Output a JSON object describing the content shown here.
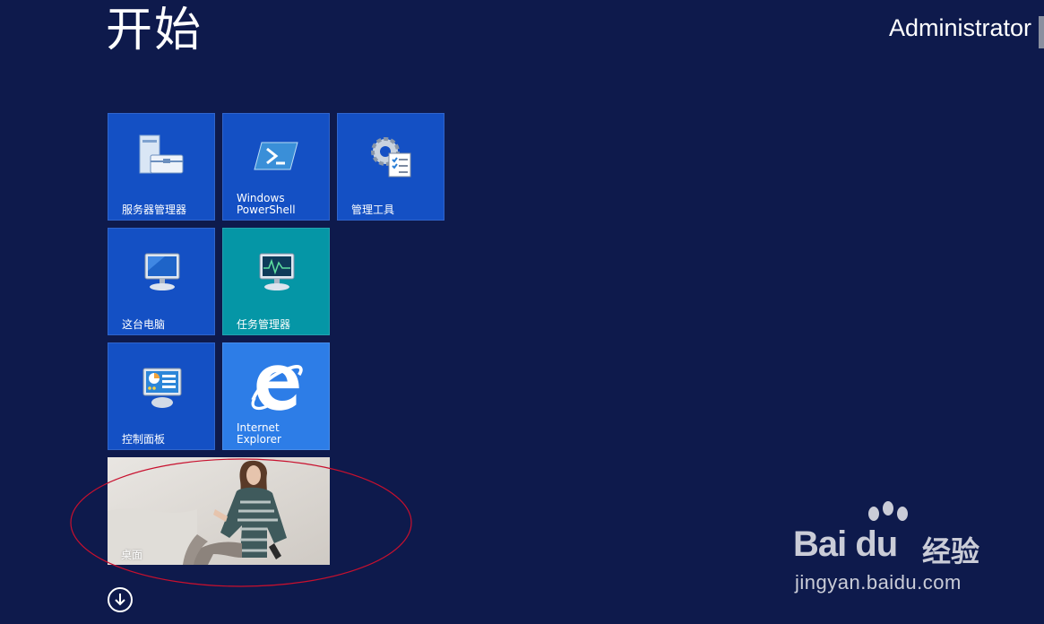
{
  "header": {
    "title": "开始",
    "user": "Administrator"
  },
  "tiles": [
    {
      "label": "服务器管理器",
      "icon": "server-manager-icon"
    },
    {
      "label": "Windows\nPowerShell",
      "icon": "powershell-icon"
    },
    {
      "label": "管理工具",
      "icon": "admin-tools-icon"
    },
    {
      "label": "这台电脑",
      "icon": "computer-icon"
    },
    {
      "label": "任务管理器",
      "icon": "task-manager-icon"
    },
    {
      "label": "控制面板",
      "icon": "control-panel-icon"
    },
    {
      "label": "Internet\nExplorer",
      "icon": "internet-explorer-icon"
    },
    {
      "label": "桌面",
      "icon": "desktop-wallpaper"
    }
  ],
  "apps_button": {
    "icon": "arrow-down-circle-icon"
  },
  "watermark": {
    "brand": "Bai du",
    "brand_cn": "经验",
    "url": "jingyan.baidu.com"
  },
  "colors": {
    "background": "#0e1a4c",
    "tile_blue": "#1450c4",
    "tile_teal": "#0596a6",
    "tile_ie": "#2d7de7",
    "annotation": "#c8102e"
  }
}
